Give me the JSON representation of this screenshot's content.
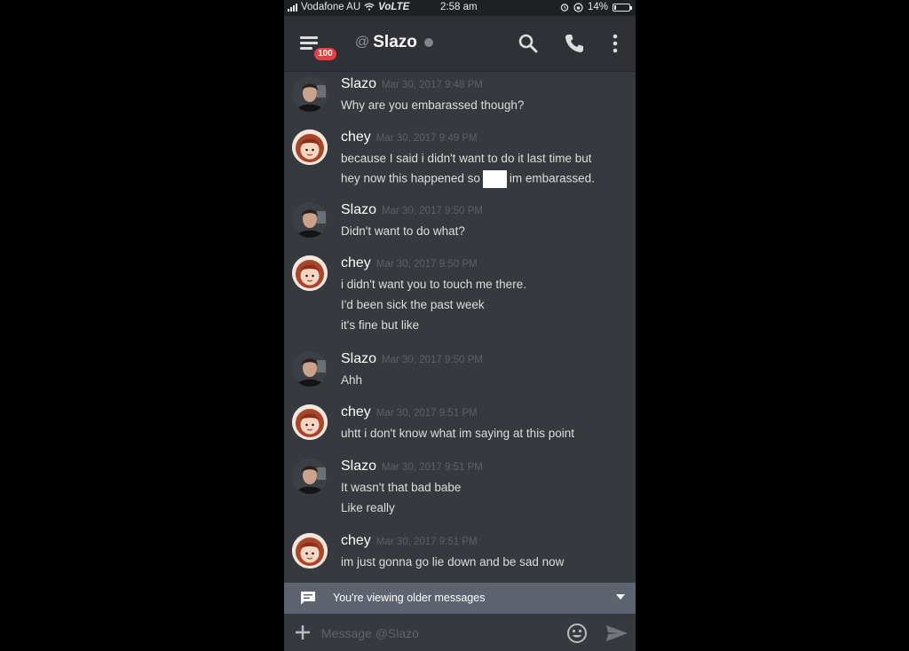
{
  "status_bar": {
    "carrier": "Vodafone AU",
    "network": "VoLTE",
    "time": "2:58 am",
    "battery": "14%",
    "battery_level": 0.14
  },
  "header": {
    "badge_count": "100",
    "at_symbol": "@",
    "channel_name": "Slazo",
    "icons": [
      "hamburger-menu-icon",
      "search-icon",
      "phone-icon",
      "more-vertical-icon"
    ]
  },
  "messages": [
    {
      "author": "Slazo",
      "avatar": "slazo",
      "timestamp": "Mar 30, 2017 9:48 PM",
      "lines": [
        "Why are you embarassed though?"
      ]
    },
    {
      "author": "chey",
      "avatar": "chey",
      "timestamp": "Mar 30, 2017 9:49 PM",
      "lines": [
        "because I said i didn't want to do it last time but"
      ],
      "redacted_line": {
        "before": "hey now this happened so",
        "after": "im embarassed."
      }
    },
    {
      "author": "Slazo",
      "avatar": "slazo",
      "timestamp": "Mar 30, 2017 9:50 PM",
      "lines": [
        "Didn't want to do what?"
      ]
    },
    {
      "author": "chey",
      "avatar": "chey",
      "timestamp": "Mar 30, 2017 9:50 PM",
      "lines": [
        "i didn't want you to touch me there.",
        "I'd been sick the past week",
        "it's fine but like"
      ]
    },
    {
      "author": "Slazo",
      "avatar": "slazo",
      "timestamp": "Mar 30, 2017 9:50 PM",
      "lines": [
        "Ahh"
      ]
    },
    {
      "author": "chey",
      "avatar": "chey",
      "timestamp": "Mar 30, 2017 9:51 PM",
      "lines": [
        "uhtt i don't know what im saying at this point"
      ]
    },
    {
      "author": "Slazo",
      "avatar": "slazo",
      "timestamp": "Mar 30, 2017 9:51 PM",
      "lines": [
        "It wasn't that bad babe",
        "Like really"
      ]
    },
    {
      "author": "chey",
      "avatar": "chey",
      "timestamp": "Mar 30, 2017 9:51 PM",
      "lines": [
        "im just gonna go lie down and be sad now"
      ]
    }
  ],
  "older_messages_bar": {
    "text": "You're viewing older messages",
    "icon": "message-icon"
  },
  "composer": {
    "placeholder": "Message @Slazo",
    "icons": [
      "plus-icon",
      "emoji-icon",
      "send-icon"
    ]
  },
  "colors": {
    "background": "#36393e",
    "header": "#2f3136",
    "badge": "#e83e3e",
    "older_bar": "#5d646f"
  }
}
